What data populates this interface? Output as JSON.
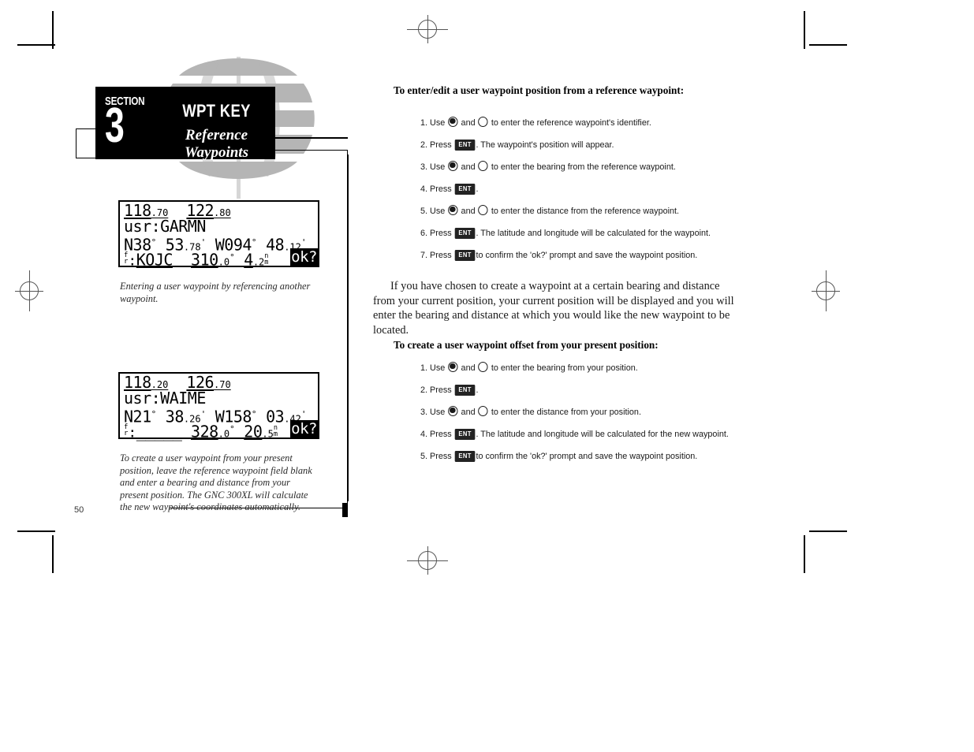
{
  "document": {
    "page_number": "50"
  },
  "section_header": {
    "section_label": "SECTION",
    "section_number": "3",
    "title": "WPT KEY",
    "subtitle": "Reference Waypoints"
  },
  "lcd_screen_1": {
    "row1": {
      "freq_active": "118",
      "freq_active_dec": ".70",
      "freq_standby": "122",
      "freq_standby_dec": ".80"
    },
    "row2": {
      "label": "usr:",
      "value": "GARMN"
    },
    "row3": {
      "lat_deg": "N38",
      "lat_min": "53",
      "lat_min_dec": ".78",
      "lon_deg": "W094",
      "lon_min": "48",
      "lon_min_dec": ".12"
    },
    "row4": {
      "fr_label_top": "f",
      "fr_label_bot": "r",
      "fr_colon": ":",
      "ref_waypoint": "KOJC",
      "bearing": "310",
      "bearing_dec": ".0",
      "distance": "4",
      "distance_dec": ".2",
      "unit_top": "n",
      "unit_bot": "m",
      "ok_prompt": "ok?"
    }
  },
  "lcd_screen_2": {
    "row1": {
      "freq_active": "118",
      "freq_active_dec": ".20",
      "freq_standby": "126",
      "freq_standby_dec": ".70"
    },
    "row2": {
      "label": "usr:",
      "value": "WAIME"
    },
    "row3": {
      "lat_deg": "N21",
      "lat_min": "38",
      "lat_min_dec": ".26",
      "lon_deg": "W158",
      "lon_min": "03",
      "lon_min_dec": ".42"
    },
    "row4": {
      "fr_label_top": "f",
      "fr_label_bot": "r",
      "fr_colon": ":",
      "ref_waypoint": "_____",
      "bearing": "328",
      "bearing_dec": ".0",
      "distance": "20",
      "distance_dec": ".5",
      "unit_top": "n",
      "unit_bot": "m",
      "ok_prompt": "ok?"
    }
  },
  "captions": {
    "caption_1": "Entering a user waypoint by referencing another waypoint.",
    "caption_2": "To create a user waypoint from your present position, leave the reference waypoint field blank and enter a bearing and distance from your present position. The GNC 300XL will calculate the new waypoint's coordinates automatically."
  },
  "right_column": {
    "heading_1": "To enter/edit a user waypoint position from a reference waypoint:",
    "procedure_1": [
      {
        "num": "1.",
        "verb": "Use",
        "knobs": true,
        "conj": "and",
        "tail": "to enter the reference waypoint's identifier."
      },
      {
        "num": "2.",
        "verb": "Press",
        "key": "ENT",
        "tail": ". The waypoint's position will appear."
      },
      {
        "num": "3.",
        "verb": "Use",
        "knobs": true,
        "conj": "and",
        "tail": "to enter the bearing from the reference waypoint."
      },
      {
        "num": "4.",
        "verb": "Press",
        "key": "ENT",
        "tail": "."
      },
      {
        "num": "5.",
        "verb": "Use",
        "knobs": true,
        "conj": "and",
        "tail": "to enter the distance from the reference waypoint."
      },
      {
        "num": "6.",
        "verb": "Press",
        "key": "ENT",
        "tail": ". The latitude and longitude will be calculated for the waypoint."
      },
      {
        "num": "7.",
        "verb": "Press",
        "key": "ENT",
        "tail": "to confirm the 'ok?' prompt and save the waypoint position."
      }
    ],
    "body_paragraph": "If you have chosen to create a waypoint at a certain bearing and distance from your current position, your current position will be displayed and you will enter the bearing and distance at which you would like the new waypoint to be located.",
    "heading_2": "To create a user waypoint offset from your present position:",
    "procedure_2": [
      {
        "num": "1.",
        "verb": "Use",
        "knobs": true,
        "conj": "and",
        "tail": "to enter the bearing from your position."
      },
      {
        "num": "2.",
        "verb": "Press",
        "key": "ENT",
        "tail": "."
      },
      {
        "num": "3.",
        "verb": "Use",
        "knobs": true,
        "conj": "and",
        "tail": "to enter the distance from your position."
      },
      {
        "num": "4.",
        "verb": "Press",
        "key": "ENT",
        "tail": ". The latitude and longitude will be calculated for the new waypoint."
      },
      {
        "num": "5.",
        "verb": "Press",
        "key": "ENT",
        "tail": "to confirm the 'ok?' prompt and save the waypoint position."
      }
    ]
  },
  "colors": {
    "ink": "#000000",
    "watermark_gray": "#b5b5b5",
    "header_bg": "#000000"
  }
}
